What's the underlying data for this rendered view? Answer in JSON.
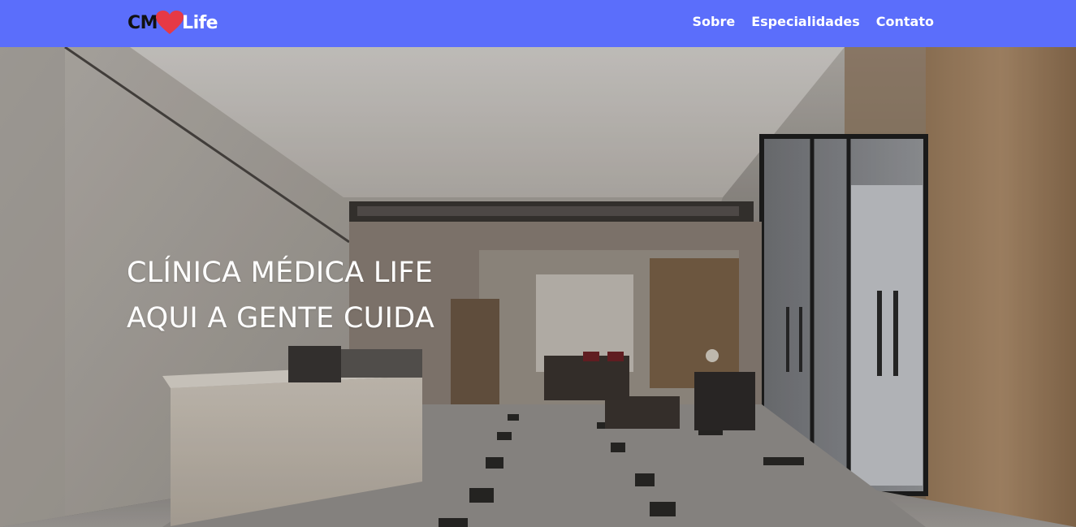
{
  "brand": {
    "prefix": "CM",
    "suffix": "Life",
    "heart_color": "#e63946",
    "nav_color": "#5b6efb"
  },
  "nav": {
    "items": [
      {
        "label": "Sobre"
      },
      {
        "label": "Especialidades"
      },
      {
        "label": "Contato"
      }
    ]
  },
  "hero": {
    "line1": "CLÍNICA MÉDICA LIFE",
    "line2": "AQUI A GENTE CUIDA"
  }
}
